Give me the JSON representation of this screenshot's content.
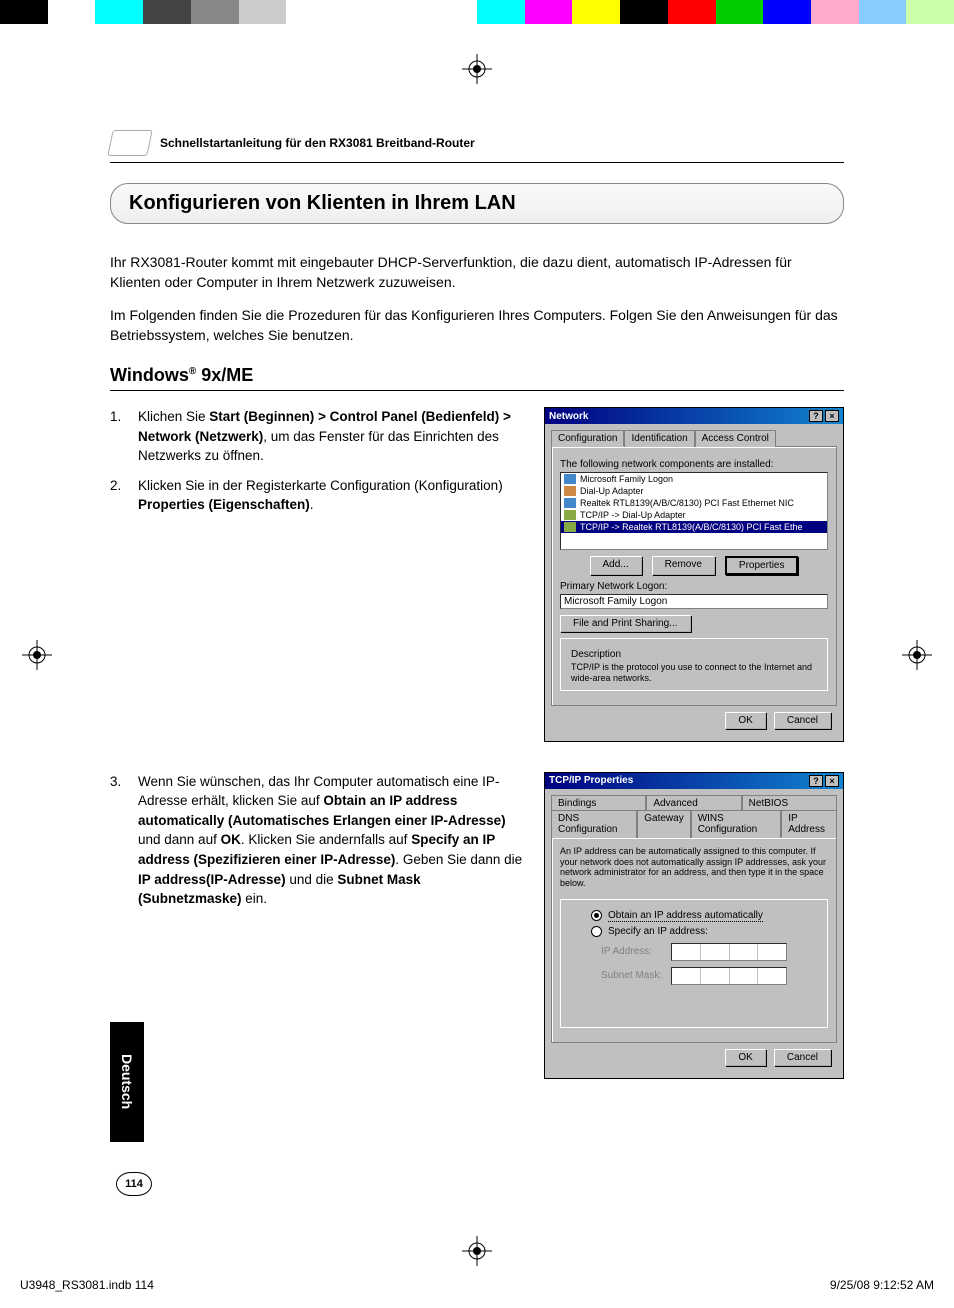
{
  "header": {
    "doc_title": "Schnellstartanleitung für den RX3081 Breitband-Router"
  },
  "section_title": "Konfigurieren von Klienten in Ihrem LAN",
  "intro": {
    "p1": "Ihr RX3081-Router kommt mit eingebauter DHCP-Serverfunktion, die dazu dient, automatisch IP-Adressen für Klienten oder Computer in Ihrem Netzwerk zuzuweisen.",
    "p2": "Im Folgenden finden Sie die Prozeduren für das Konfigurieren Ihres Computers. Folgen Sie den Anweisungen für das Betriebssystem, welches Sie benutzen."
  },
  "subheading": "Windows",
  "subheading_suffix": " 9x/ME",
  "steps": {
    "s1_pre": "Klichen Sie ",
    "s1_bold": "Start (Beginnen) > Control Panel (Bedienfeld) > Network (Netzwerk)",
    "s1_post": ", um das Fenster für das Einrichten des Netzwerks zu öffnen.",
    "s2_pre": "Klicken Sie in der Registerkarte Configuration (Konfiguration) ",
    "s2_bold": "Properties (Eigenschaften)",
    "s2_post": ".",
    "s3_pre": "Wenn Sie wünschen, das Ihr Computer automatisch eine IP-Adresse erhält, klicken Sie auf ",
    "s3_b1": "Obtain an IP address automatically (Automatisches Erlangen einer IP-Adresse)",
    "s3_mid1": " und dann auf ",
    "s3_b2": "OK",
    "s3_mid2": ". Klicken Sie andernfalls auf ",
    "s3_b3": "Specify an IP address (Spezifizieren einer IP-Adresse)",
    "s3_mid3": ". Geben Sie dann die ",
    "s3_b4": "IP address(IP-Adresse)",
    "s3_mid4": " und die ",
    "s3_b5": "Subnet Mask (Subnetzmaske)",
    "s3_post": " ein."
  },
  "dialog1": {
    "title": "Network",
    "tabs": [
      "Configuration",
      "Identification",
      "Access Control"
    ],
    "list_label": "The following network components are installed:",
    "items": [
      "Microsoft Family Logon",
      "Dial-Up Adapter",
      "Realtek RTL8139(A/B/C/8130) PCI Fast Ethernet NIC",
      "TCP/IP -> Dial-Up Adapter",
      "TCP/IP -> Realtek RTL8139(A/B/C/8130) PCI Fast Ethe"
    ],
    "btn_add": "Add...",
    "btn_remove": "Remove",
    "btn_properties": "Properties",
    "primary_label": "Primary Network Logon:",
    "primary_value": "Microsoft Family Logon",
    "btn_fileshare": "File and Print Sharing...",
    "desc_label": "Description",
    "desc_text": "TCP/IP is the protocol you use to connect to the Internet and wide-area networks.",
    "ok": "OK",
    "cancel": "Cancel"
  },
  "dialog2": {
    "title": "TCP/IP Properties",
    "tabs_row1": [
      "Bindings",
      "Advanced",
      "NetBIOS"
    ],
    "tabs_row2": [
      "DNS Configuration",
      "Gateway",
      "WINS Configuration",
      "IP Address"
    ],
    "desc": "An IP address can be automatically assigned to this computer. If your network does not automatically assign IP addresses, ask your network administrator for an address, and then type it in the space below.",
    "radio1": "Obtain an IP address automatically",
    "radio2": "Specify an IP address:",
    "ip_label": "IP Address:",
    "mask_label": "Subnet Mask:",
    "ok": "OK",
    "cancel": "Cancel"
  },
  "langtab": "Deutsch",
  "page_number": "114",
  "footer": {
    "left": "U3948_RS3081.indb   114",
    "right": "9/25/08   9:12:52 AM"
  }
}
